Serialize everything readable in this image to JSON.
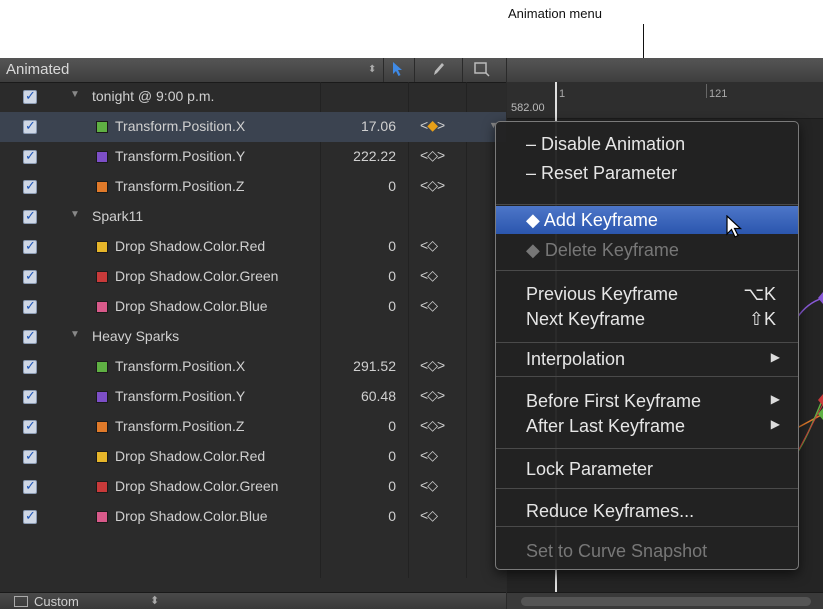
{
  "callout": "Animation menu",
  "list": {
    "header_title": "Animated",
    "rows": [
      {
        "type": "group",
        "name": "tonight @ 9:00 p.m."
      },
      {
        "type": "param",
        "color": "#5fb043",
        "name": "Transform.Position.X",
        "value": "17.06",
        "kf": "<◆>",
        "active": true,
        "selected": true
      },
      {
        "type": "param",
        "color": "#7d4fc7",
        "name": "Transform.Position.Y",
        "value": "222.22",
        "kf": "<◇>"
      },
      {
        "type": "param",
        "color": "#e07a2a",
        "name": "Transform.Position.Z",
        "value": "0",
        "kf": "<◇>"
      },
      {
        "type": "group",
        "name": "Spark11"
      },
      {
        "type": "param",
        "color": "#e6b52a",
        "name": "Drop Shadow.Color.Red",
        "value": "0",
        "kf": "<◇"
      },
      {
        "type": "param",
        "color": "#c83a3a",
        "name": "Drop Shadow.Color.Green",
        "value": "0",
        "kf": "<◇"
      },
      {
        "type": "param",
        "color": "#d85a8a",
        "name": "Drop Shadow.Color.Blue",
        "value": "0",
        "kf": "<◇"
      },
      {
        "type": "group",
        "name": "Heavy Sparks"
      },
      {
        "type": "param",
        "color": "#5fb043",
        "name": "Transform.Position.X",
        "value": "291.52",
        "kf": "<◇>"
      },
      {
        "type": "param",
        "color": "#7d4fc7",
        "name": "Transform.Position.Y",
        "value": "60.48",
        "kf": "<◇>"
      },
      {
        "type": "param",
        "color": "#e07a2a",
        "name": "Transform.Position.Z",
        "value": "0",
        "kf": "<◇>"
      },
      {
        "type": "param",
        "color": "#e6b52a",
        "name": "Drop Shadow.Color.Red",
        "value": "0",
        "kf": "<◇"
      },
      {
        "type": "param",
        "color": "#c83a3a",
        "name": "Drop Shadow.Color.Green",
        "value": "0",
        "kf": "<◇"
      },
      {
        "type": "param",
        "color": "#d85a8a",
        "name": "Drop Shadow.Color.Blue",
        "value": "0",
        "kf": "<◇"
      }
    ],
    "footer_label": "Custom"
  },
  "timeline": {
    "ruler_start": "1",
    "ruler_mark": "121",
    "value_readout": "582.00"
  },
  "menu": {
    "items": [
      {
        "label": "– Disable Animation"
      },
      {
        "label": "– Reset Parameter"
      },
      {
        "sep": true
      },
      {
        "label": "◆ Add Keyframe",
        "highlighted": true
      },
      {
        "label": "◆ Delete Keyframe",
        "disabled": true
      },
      {
        "sep": true
      },
      {
        "label": "Previous Keyframe",
        "shortcut": "⌥K"
      },
      {
        "label": "Next Keyframe",
        "shortcut": "⇧K"
      },
      {
        "sep": true
      },
      {
        "label": "Interpolation",
        "submenu": true
      },
      {
        "sep": true
      },
      {
        "label": "Before First Keyframe",
        "submenu": true
      },
      {
        "label": "After Last Keyframe",
        "submenu": true
      },
      {
        "sep": true
      },
      {
        "label": "Lock Parameter"
      },
      {
        "sep": true
      },
      {
        "label": "Reduce Keyframes..."
      },
      {
        "sep": true
      },
      {
        "label": "Set to Curve Snapshot",
        "disabled": true
      }
    ]
  }
}
